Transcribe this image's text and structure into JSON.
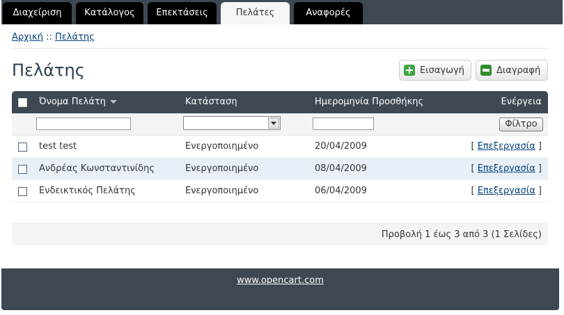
{
  "nav": {
    "tabs": [
      {
        "label": "Διαχείριση",
        "active": false
      },
      {
        "label": "Κατάλογος",
        "active": false
      },
      {
        "label": "Επεκτάσεις",
        "active": false
      },
      {
        "label": "Πελάτες",
        "active": true
      },
      {
        "label": "Αναφορές",
        "active": false
      }
    ]
  },
  "breadcrumb": {
    "home": "Αρχική",
    "separator": " :: ",
    "current": "Πελάτης"
  },
  "page": {
    "title": "Πελάτης"
  },
  "toolbar": {
    "insert_label": "Εισαγωγή",
    "delete_label": "Διαγραφή"
  },
  "table": {
    "columns": {
      "name": "Όνομα Πελάτη",
      "status": "Κατάσταση",
      "date_added": "Ημερομηνία Προσθήκης",
      "action": "Ενέργεια"
    },
    "filter": {
      "name_value": "",
      "status_value": "",
      "date_value": "",
      "button_label": "Φίλτρο"
    },
    "rows": [
      {
        "name": "test test",
        "status": "Ενεργοποιημένο",
        "date": "20/04/2009",
        "action": "Επεξεργασία"
      },
      {
        "name": "Ανδρέας Κωνσταντινίδης",
        "status": "Ενεργοποιημένο",
        "date": "08/04/2009",
        "action": "Επεξεργασία"
      },
      {
        "name": "Ενδεικτικός Πελάτης",
        "status": "Ενεργοποιημένο",
        "date": "06/04/2009",
        "action": "Επεξεργασία"
      }
    ],
    "action_open": "[ ",
    "action_close": " ]"
  },
  "pagination": {
    "text": "Προβολή 1 έως 3 από 3 (1 Σελίδες)"
  },
  "footer": {
    "link": "www.opencart.com"
  },
  "colors": {
    "header_bg": "#3d4853",
    "tab_bg": "#000000",
    "active_tab_bg": "#f5f5f5",
    "link": "#00407a",
    "alt_row": "#e9eff7"
  },
  "icons": {
    "insert": "plus-icon",
    "delete": "minus-icon",
    "sort": "sort-down-icon",
    "select_arrow": "chevron-down-icon"
  }
}
